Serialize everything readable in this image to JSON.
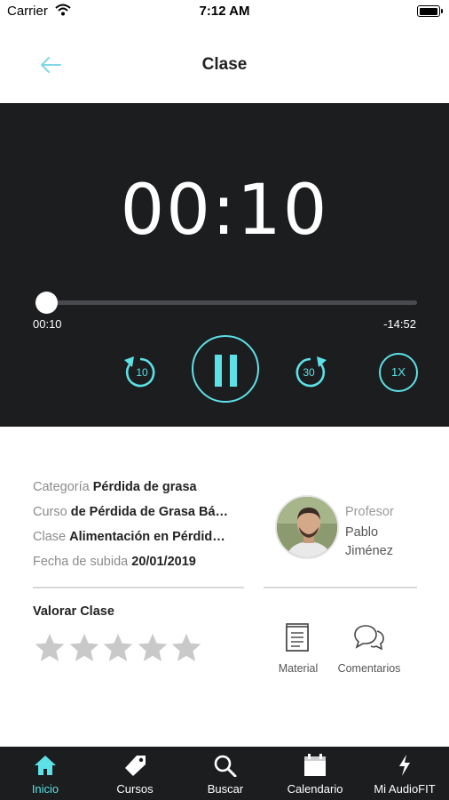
{
  "status_bar": {
    "carrier": "Carrier",
    "time": "7:12 AM"
  },
  "header": {
    "title": "Clase"
  },
  "player": {
    "clock": "00:10",
    "elapsed": "00:10",
    "remaining": "-14:52",
    "progress": 0.011,
    "rewind_label": "10",
    "forward_label": "30",
    "speed_label": "1X",
    "accent_color": "#5ce1e6"
  },
  "info": {
    "category": {
      "label": "Categoría",
      "value": "Pérdida de grasa"
    },
    "course": {
      "label": "Curso",
      "value": "de Pérdida de Grasa Bá…"
    },
    "class": {
      "label": "Clase",
      "value": "Alimentación en Pérdid…"
    },
    "date": {
      "label": "Fecha de subida",
      "value": "20/01/2019"
    },
    "professor": {
      "role": "Profesor",
      "name": "Pablo Jiménez"
    }
  },
  "rating": {
    "title": "Valorar Clase",
    "stars_total": 5,
    "stars_selected": 0
  },
  "actions": {
    "material": "Material",
    "comments": "Comentarios"
  },
  "tabbar": {
    "items": [
      {
        "label": "Inicio",
        "icon": "home-icon",
        "active": true
      },
      {
        "label": "Cursos",
        "icon": "tag-icon",
        "active": false
      },
      {
        "label": "Buscar",
        "icon": "search-icon",
        "active": false
      },
      {
        "label": "Calendario",
        "icon": "calendar-icon",
        "active": false
      },
      {
        "label": "Mi AudioFIT",
        "icon": "bolt-icon",
        "active": false
      }
    ]
  }
}
